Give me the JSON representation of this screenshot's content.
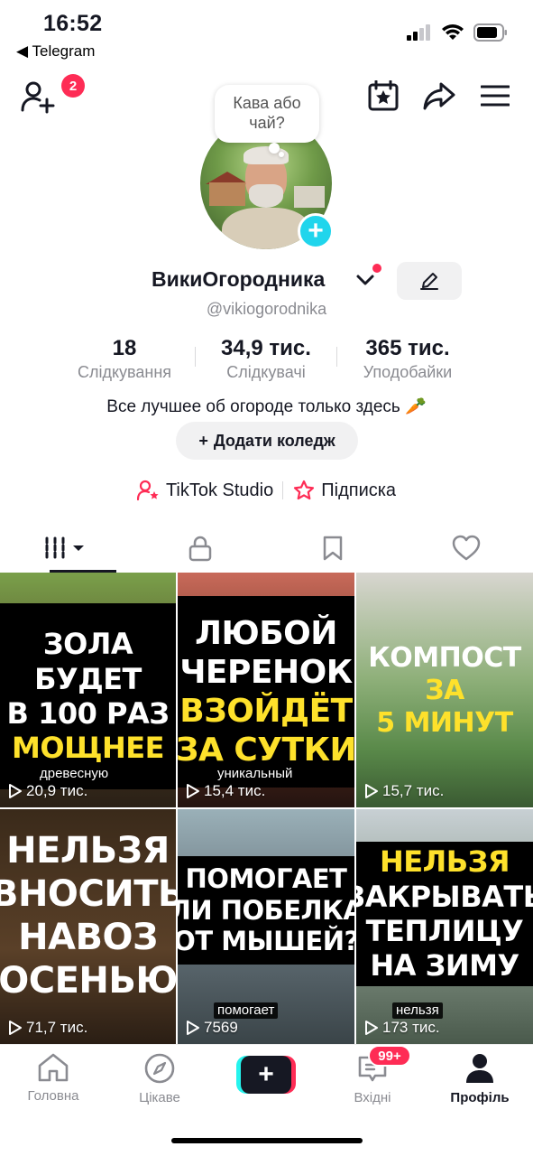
{
  "status_bar": {
    "time": "16:52",
    "back_app": "◀ Telegram"
  },
  "top_nav": {
    "friends_badge": "2"
  },
  "profile": {
    "bubble": "Кава або чай?",
    "display_name": "ВикиОгородника",
    "username": "@vikiogorodnika",
    "stats": [
      {
        "value": "18",
        "label": "Слідкування"
      },
      {
        "value": "34,9 тис.",
        "label": "Слідкувачі"
      },
      {
        "value": "365 тис.",
        "label": "Уподобайки"
      }
    ],
    "bio": "Все лучшее об огороде только здесь 🥕",
    "add_college": "Додати коледж",
    "links": {
      "studio": "TikTok Studio",
      "subscription": "Підписка"
    }
  },
  "videos": [
    {
      "lines": [
        [
          "ЗОЛА",
          "w"
        ],
        [
          "БУДЕТ",
          "w"
        ],
        [
          "В 100 РАЗ",
          "w"
        ],
        [
          "МОЩНЕЕ",
          "y"
        ]
      ],
      "views": "20,9 тис.",
      "caption": "древесную"
    },
    {
      "lines": [
        [
          "ЛЮБОЙ",
          "w"
        ],
        [
          "ЧЕРЕНОК",
          "w"
        ],
        [
          "ВЗОЙДЁТ",
          "y"
        ],
        [
          "ЗА СУТКИ",
          "y"
        ]
      ],
      "views": "15,4 тис.",
      "caption": "уникальный"
    },
    {
      "lines": [
        [
          "КОМПОСТ",
          "w"
        ],
        [
          "ЗА",
          "y"
        ],
        [
          "5 МИНУТ",
          "y"
        ]
      ],
      "views": "15,7 тис.",
      "caption": ""
    },
    {
      "lines": [
        [
          "НЕЛЬЗЯ",
          "w"
        ],
        [
          "ВНОСИТЬ",
          "w"
        ],
        [
          "НАВОЗ",
          "w"
        ],
        [
          "ОСЕНЬЮ",
          "w"
        ]
      ],
      "views": "71,7 тис.",
      "caption": ""
    },
    {
      "lines": [
        [
          "ПОМОГАЕТ",
          "w"
        ],
        [
          "ЛИ ПОБЕЛКА",
          "w"
        ],
        [
          "ОТ МЫШЕЙ?",
          "w"
        ]
      ],
      "views": "7569",
      "caption": "помогает"
    },
    {
      "lines": [
        [
          "НЕЛЬЗЯ",
          "y"
        ],
        [
          "ЗАКРЫВАТЬ",
          "w"
        ],
        [
          "ТЕПЛИЦУ",
          "w"
        ],
        [
          "НА ЗИМУ",
          "w"
        ]
      ],
      "views": "173 тис.",
      "caption": "нельзя"
    }
  ],
  "bottom_nav": {
    "home": "Головна",
    "discover": "Цікаве",
    "create": "+",
    "inbox": "Вхідні",
    "inbox_badge": "99+",
    "profile": "Профіль"
  },
  "colors": {
    "accent": "#fe2c55",
    "cyan": "#20d5ec",
    "yellow_text": "#fee12b"
  }
}
